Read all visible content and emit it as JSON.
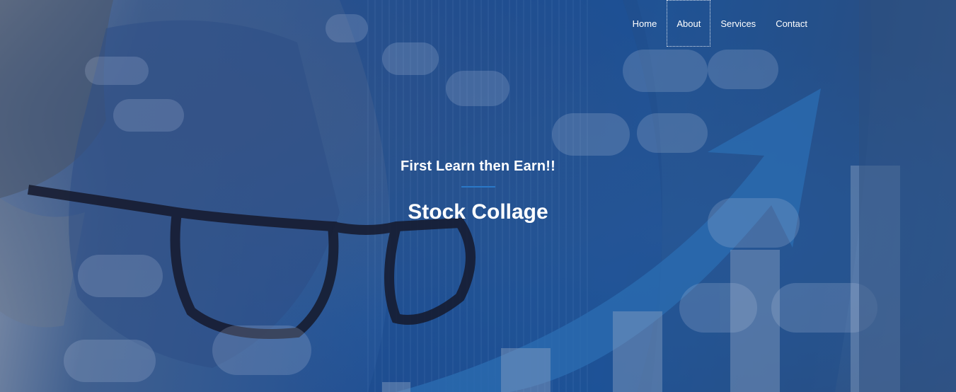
{
  "nav": {
    "items": [
      {
        "label": "Home",
        "active": false
      },
      {
        "label": "About",
        "active": true
      },
      {
        "label": "Services",
        "active": false
      },
      {
        "label": "Contact",
        "active": false
      }
    ]
  },
  "hero": {
    "tagline": "First Learn then Earn!!",
    "title": "Stock Collage"
  },
  "colors": {
    "overlay_blue": "#1f4f94",
    "divider": "#2a78c8",
    "text": "#ffffff"
  }
}
